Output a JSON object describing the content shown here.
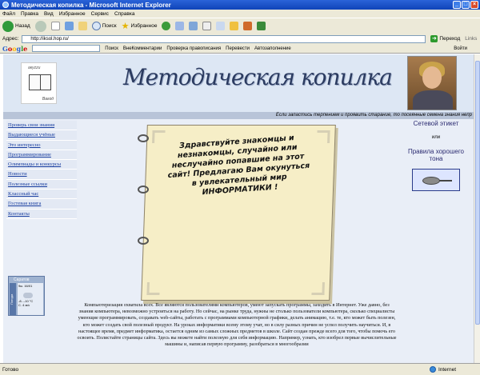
{
  "window": {
    "title": "Методическая копилка - Microsoft Internet Explorer",
    "minimize": "_",
    "maximize": "□",
    "close": "×"
  },
  "menu": [
    "Файл",
    "Правка",
    "Вид",
    "Избранное",
    "Сервис",
    "Справка"
  ],
  "toolbar": {
    "back": "Назад",
    "search": "Поиск",
    "favorites": "Избранное"
  },
  "address": {
    "label": "Адрес:",
    "url": "http://iksol.hop.ru/",
    "go": "Переход",
    "links": "Links"
  },
  "googlebar": {
    "logo": [
      "G",
      "o",
      "o",
      "g",
      "l",
      "e"
    ],
    "search": "Поиск",
    "items": [
      "ВнеКомментарии",
      "Проверка правописания",
      "Перевести",
      "Автозаполнение"
    ],
    "signin": "Войти"
  },
  "page": {
    "logo_top": "акуzzи",
    "logo_bottom": "Вагод",
    "title": "Методическая копилка",
    "marquee": "Если запастись терпением и проявить старание, то посеянные семена знания непр",
    "nav": [
      "Проверь свои знания",
      "Выдающиеся учёные",
      "Это интересно",
      "Программирование",
      "Олимпиады и конкурсы",
      "Новости",
      "Полезные ссылки",
      "Классный час",
      "Гостевая книга",
      "Контакты"
    ],
    "weather": {
      "city": "Саратов",
      "side": "Погода",
      "line1": "9ы. 16/01",
      "line2": "-8...-10 °C",
      "line3": "С. 4 м/с"
    },
    "book_text": "Здравствуйте знакомцы и незнакомцы, случайно или неслучайно попавшие на этот сайт! Предлагаю Вам окунуться в увлекательный мир ИНФОРМАТИКИ !",
    "right": {
      "link1": "Сетевой этикет",
      "or": "или",
      "link2": "Правила хорошего тона"
    },
    "body": "Компьютеризация охватила всех. Все являются пользователями компьютеров, умеют запускать программы, заходить в Интернет. Уже давно, без знания компьютера, невозможно устроиться на работу. Но сейчас, на рынке труда, нужны не столько пользователи компьютера, сколько специалисты умеющие программировать, создавать web-сайты, работать с программами компьютерной графики, делать анимацию, т.е. те, кто может быть полезен, кто может создать свой полезный продукт. На уроках информатики всему этому учат, но в силу разных причин не успел получить научиться. И, в настоящее время, предмет информатика, остается одним из самых сложных предметов в школе. Сайт создан прежде всего для того, чтобы помочь его освоить. Полистайте страницы сайта. Здесь вы можете найти полезную для себя информацию. Например, узнать, кто изобрел первые вычислительные машины и, написав первую программу, разобраться в многообразии"
  },
  "status": {
    "left": "Готово",
    "zone": "Internet"
  }
}
